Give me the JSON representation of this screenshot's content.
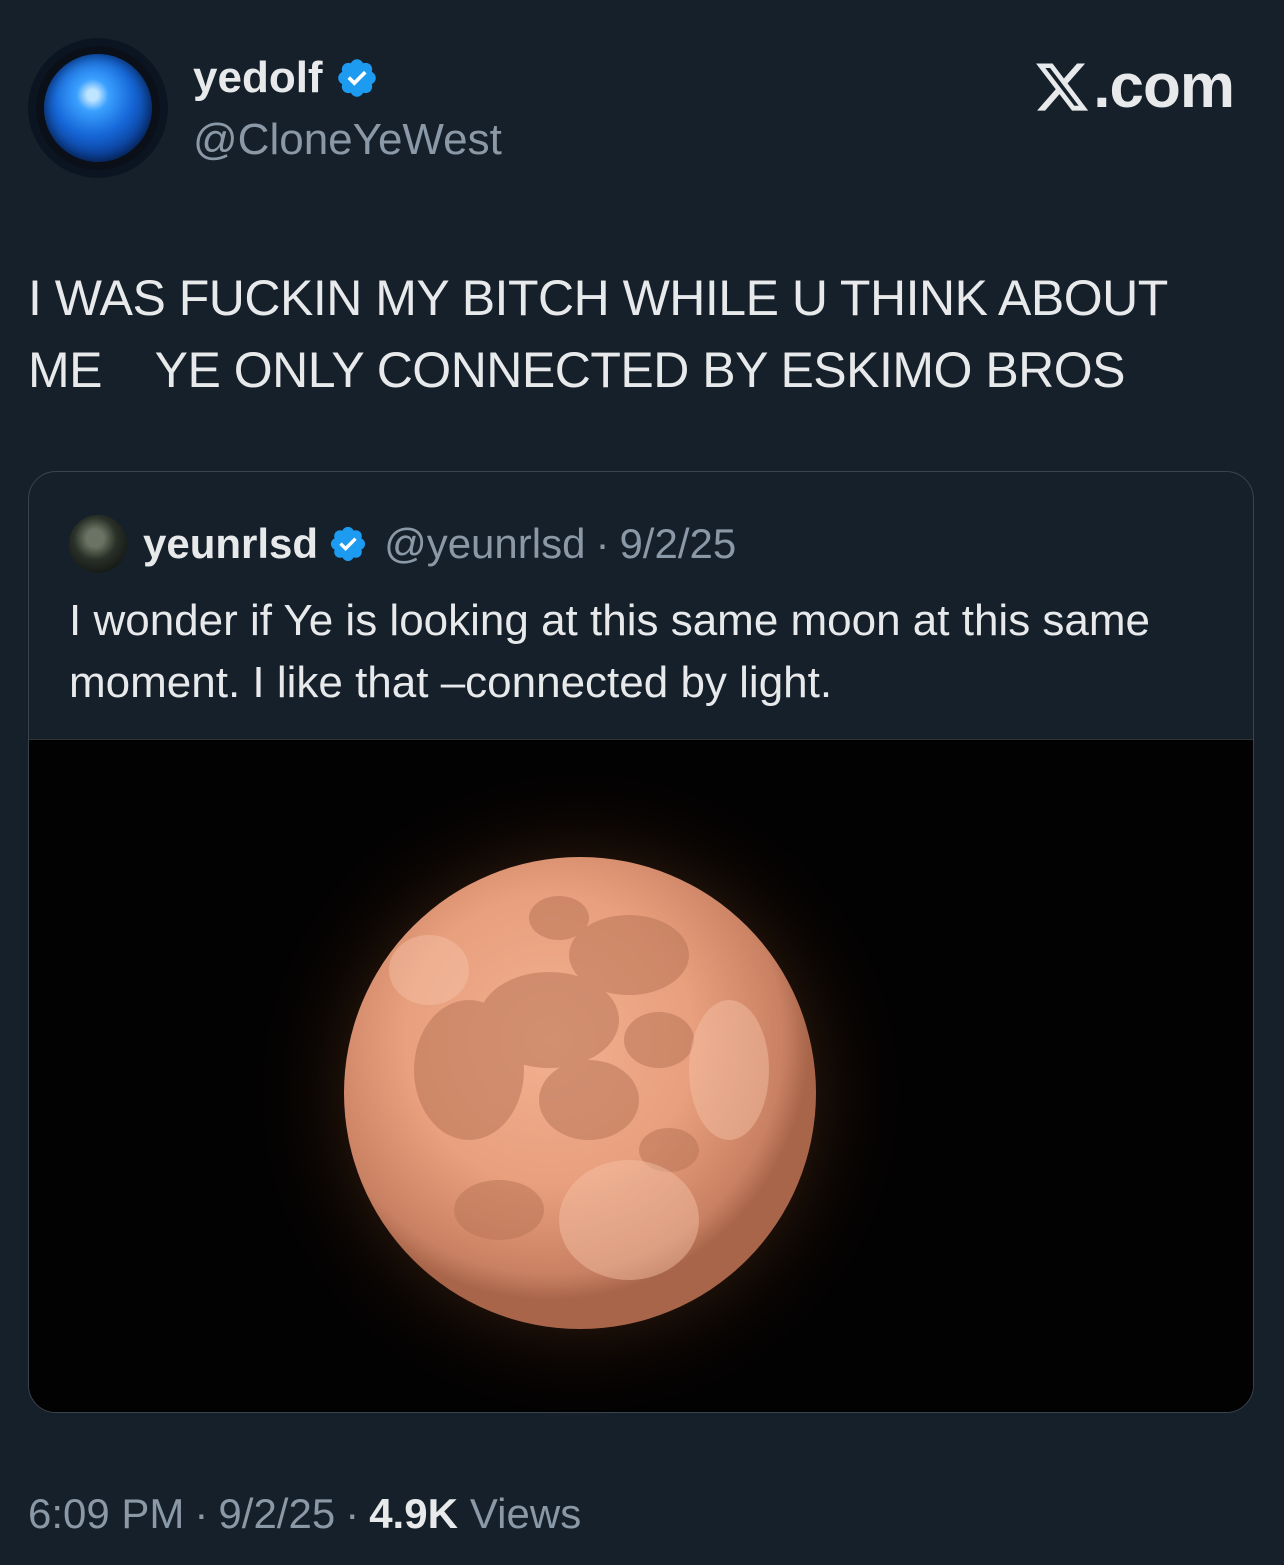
{
  "author": {
    "display_name": "yedolf",
    "handle": "@CloneYeWest",
    "verified": true
  },
  "brand": {
    "label": ".com",
    "logo_icon": "x-logo-icon"
  },
  "tweet": {
    "text": "I WAS FUCKIN MY BITCH WHILE U THINK ABOUT\nME    YE ONLY CONNECTED BY ESKIMO BROS"
  },
  "quoted_tweet": {
    "display_name": "yeunrlsd",
    "handle": "@yeunrlsd",
    "separator": "·",
    "date": "9/2/25",
    "verified": true,
    "text": "I wonder if Ye is looking at this same moon at this same moment. I like that –connected by light.",
    "media": "moon-photo"
  },
  "footer": {
    "time": "6:09 PM",
    "date": "9/2/25",
    "separator": "·",
    "views_count": "4.9K",
    "views_label": "Views"
  },
  "colors": {
    "background": "#15202b",
    "text_primary": "#e7e9ea",
    "text_secondary": "#8b98a5",
    "verified_blue": "#1d9bf0",
    "border": "#38444d"
  }
}
